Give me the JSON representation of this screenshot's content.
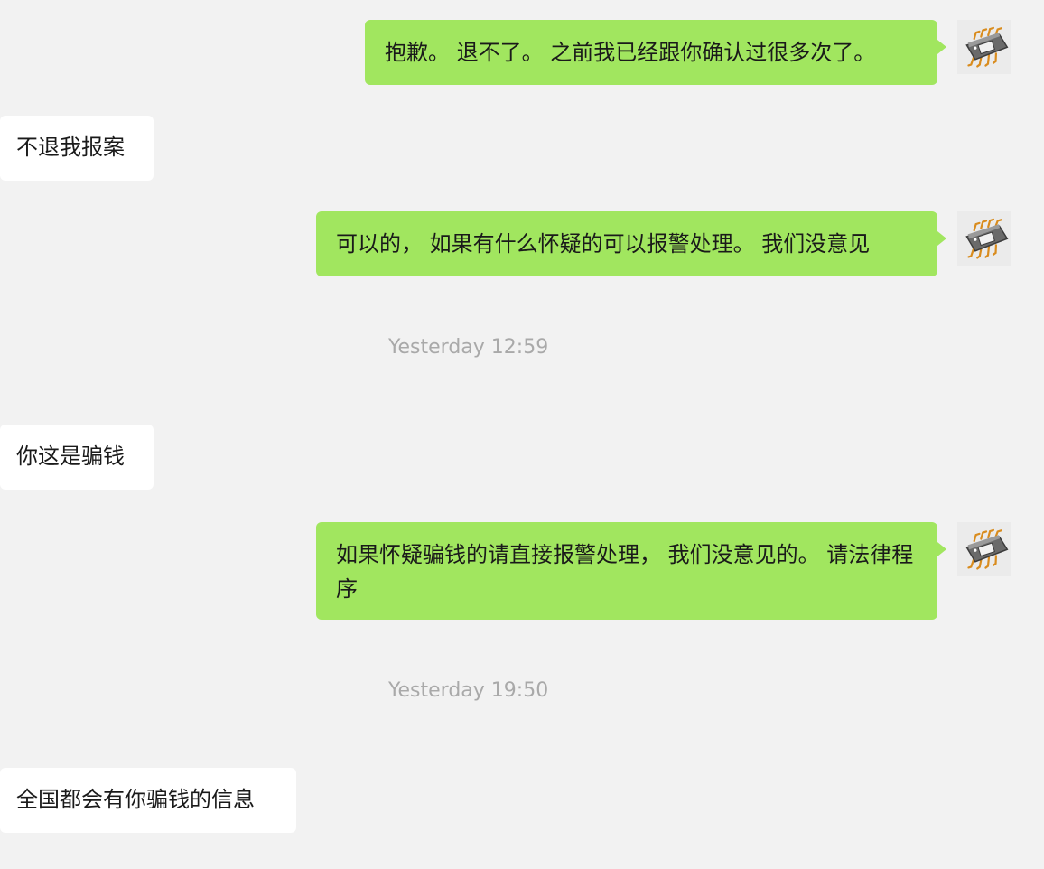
{
  "messages": [
    {
      "side": "out",
      "text": "抱歉。 退不了。 之前我已经跟你确认过很多次了。"
    },
    {
      "side": "in",
      "text": "不退我报案"
    },
    {
      "side": "out",
      "text": "可以的， 如果有什么怀疑的可以报警处理。 我们没意见"
    },
    {
      "type": "timestamp",
      "text": "Yesterday 12:59"
    },
    {
      "side": "in",
      "text": "你这是骗钱"
    },
    {
      "side": "out",
      "text": "如果怀疑骗钱的请直接报警处理， 我们没意见的。 请法律程序"
    },
    {
      "type": "timestamp",
      "text": "Yesterday 19:50"
    },
    {
      "side": "in",
      "text": "全国都会有你骗钱的信息"
    }
  ],
  "avatar_icon": "microchip-icon",
  "colors": {
    "background": "#f2f2f2",
    "outgoing_bubble": "#a1e65f",
    "incoming_bubble": "#ffffff",
    "timestamp_text": "#a9a9a9"
  }
}
